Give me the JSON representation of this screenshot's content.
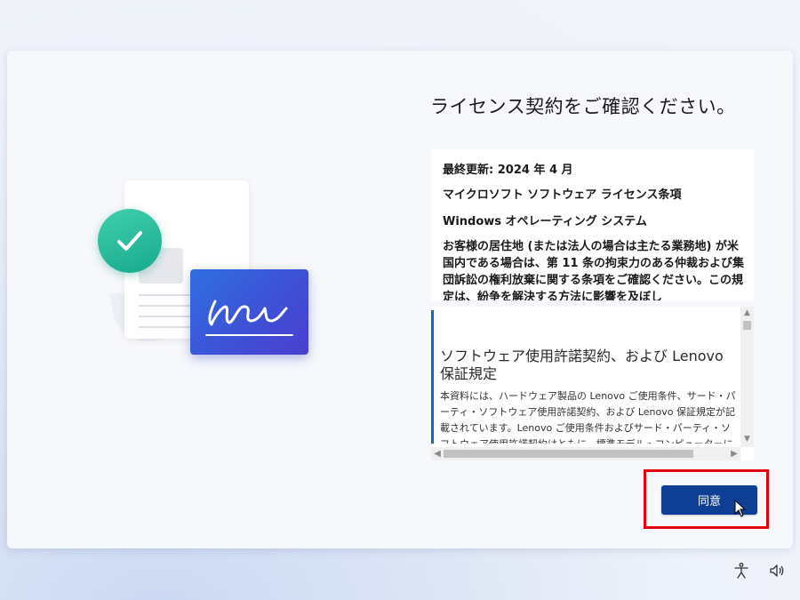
{
  "page": {
    "title": "ライセンス契約をご確認ください。"
  },
  "summary": {
    "updated": "最終更新: 2024 年 4 月",
    "heading1": "マイクロソフト ソフトウェア ライセンス条項",
    "heading2": "Windows オペレーティング システム",
    "paragraph": "お客様の居住地 (または法人の場合は主たる業務地) が米国内である場合は、第 11 条の拘束力のある仲裁および集団訴訟の権利放棄に関する条項をご確認ください。この規定は、紛争を解決する方法に影響を及ぼし"
  },
  "detail": {
    "heading": "ソフトウェア使用許諾契約、および Lenovo 保証規定",
    "body": "本資料には、ハードウェア製品の Lenovo ご使用条件、サード・パーティ・ソフトウェア使用許諾契約、および Lenovo 保証規定が記載されています。Lenovo ご使用条件およびサード・パーティ・ソフトウェア使用許諾契約はともに、標準モデル・コンピューターにプリインストールされている"
  },
  "scrollbars": {
    "up": "▲",
    "down": "▼",
    "left": "◀",
    "right": "▶"
  },
  "buttons": {
    "agree": "同意"
  },
  "tray": {
    "icons": [
      "accessibility-icon",
      "volume-icon"
    ]
  },
  "colors": {
    "accent_button": "#0e3f95",
    "highlight": "#e4000f",
    "check_green": "#22b594",
    "sign_card_blue": "#2f6fe0"
  }
}
